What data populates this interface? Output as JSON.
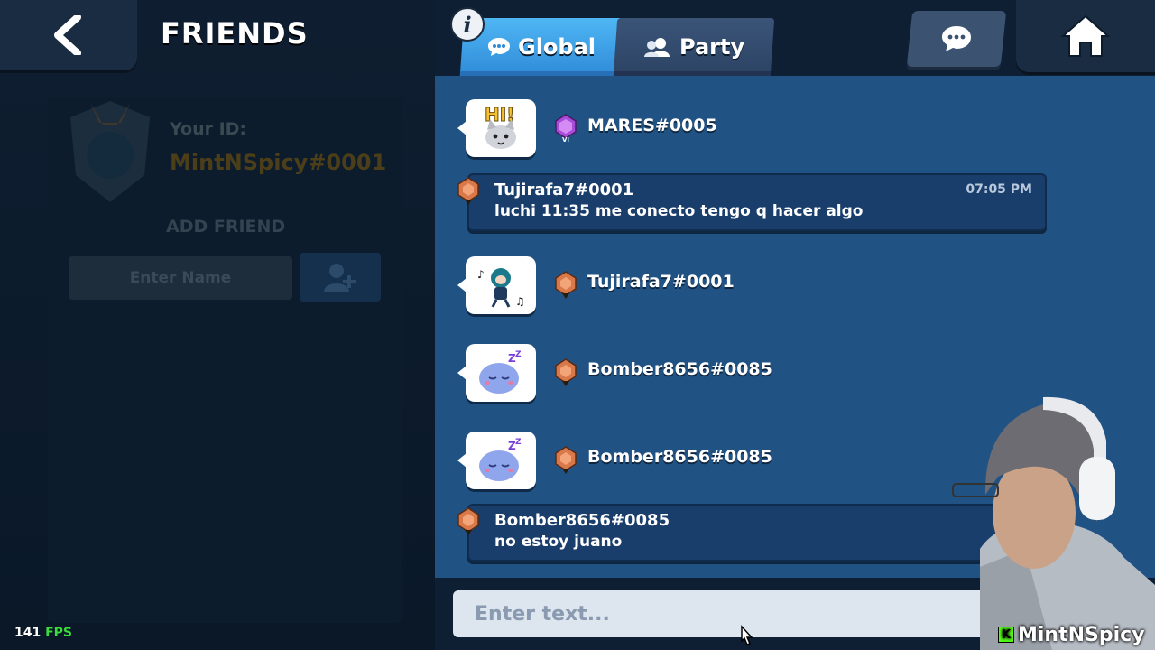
{
  "header": {
    "title": "FRIENDS"
  },
  "profile": {
    "your_id_label": "Your ID:",
    "your_id_value": "MintNSpicy#0001",
    "add_friend_label": "ADD FRIEND",
    "name_placeholder": "Enter Name"
  },
  "tabs": [
    {
      "label": "Global",
      "active": true
    },
    {
      "label": "Party",
      "active": false
    }
  ],
  "messages": [
    {
      "type": "emote",
      "emote": "hi-cat-emote",
      "user": "MARES#0005",
      "rank": "purple-VI"
    },
    {
      "type": "text",
      "user": "Tujirafa7#0001",
      "text": "luchi 11:35 me conecto tengo q hacer algo",
      "time": "07:05 PM"
    },
    {
      "type": "emote",
      "emote": "music-dance-emote",
      "user": "Tujirafa7#0001"
    },
    {
      "type": "emote",
      "emote": "sleepy-emote",
      "user": "Bomber8656#0085"
    },
    {
      "type": "emote",
      "emote": "sleepy-emote",
      "user": "Bomber8656#0085"
    },
    {
      "type": "text",
      "user": "Bomber8656#0085",
      "text": "no estoy juano"
    }
  ],
  "composer": {
    "placeholder": "Enter text..."
  },
  "overlay": {
    "fps_value": "141",
    "fps_unit": "FPS",
    "streamer": "MintNSpicy"
  },
  "colors": {
    "tab_active": "#3fa2ea",
    "chat_bg": "#215284",
    "rank_bronze": "#d9794a",
    "rank_purple": "#a84bd8"
  }
}
